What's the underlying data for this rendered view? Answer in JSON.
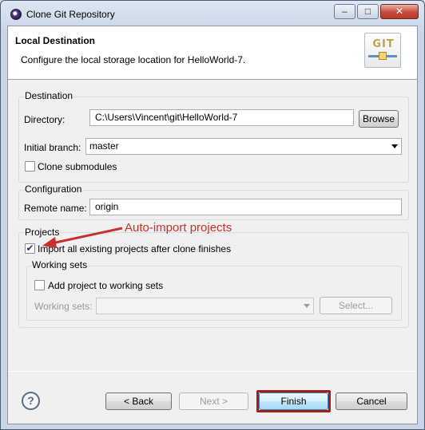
{
  "window": {
    "title": "Clone Git Repository",
    "min_glyph": "–",
    "max_glyph": "□",
    "close_glyph": "✕"
  },
  "header": {
    "title": "Local Destination",
    "description": "Configure the local storage location for HelloWorld-7.",
    "logo_text": "GIT"
  },
  "destination": {
    "group_label": "Destination",
    "directory_label": "Directory:",
    "directory_value": "C:\\Users\\Vincent\\git\\HelloWorld-7",
    "browse_label": "Browse",
    "branch_label": "Initial branch:",
    "branch_value": "master",
    "clone_submodules_label": "Clone submodules",
    "clone_submodules_checked": false
  },
  "configuration": {
    "group_label": "Configuration",
    "remote_label": "Remote name:",
    "remote_value": "origin"
  },
  "projects": {
    "group_label": "Projects",
    "import_label": "Import all existing projects after clone finishes",
    "import_checked": true,
    "import_check_glyph": "✔",
    "working_sets_group_label": "Working sets",
    "add_to_working_sets_label": "Add project to working sets",
    "add_to_working_sets_checked": false,
    "working_sets_label": "Working sets:",
    "working_sets_value": "",
    "select_label": "Select..."
  },
  "annotation": {
    "text": "Auto-import projects",
    "color": "#c9302c"
  },
  "footer": {
    "help_glyph": "?",
    "back_label": "< Back",
    "next_label": "Next >",
    "finish_label": "Finish",
    "cancel_label": "Cancel"
  },
  "colors": {
    "highlight": "#a51c1c",
    "accent": "#3399ff"
  }
}
